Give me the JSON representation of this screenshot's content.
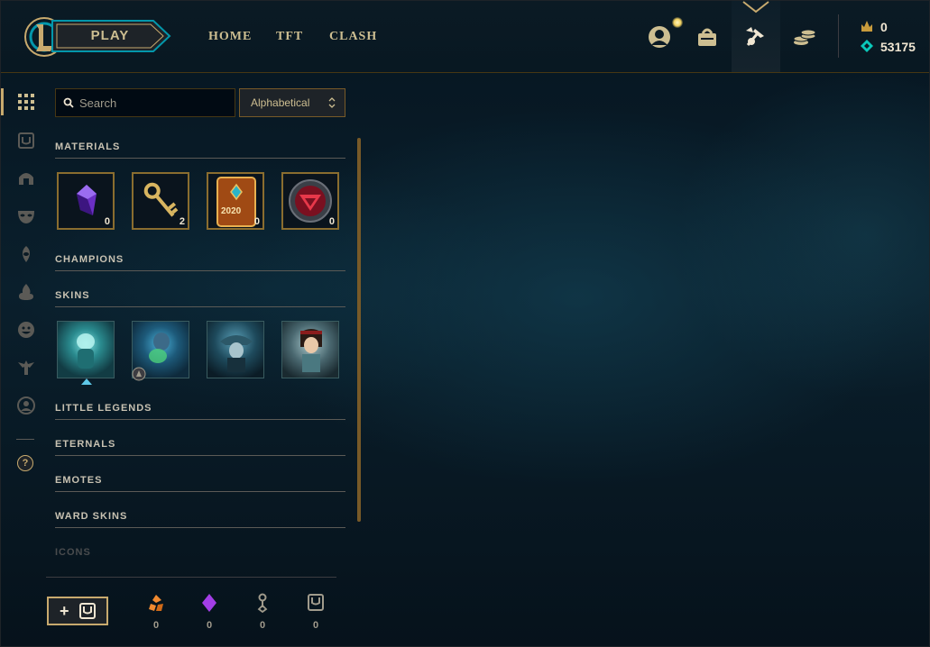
{
  "header": {
    "play_label": "PLAY",
    "nav": [
      "HOME",
      "TFT",
      "CLASH"
    ],
    "icons": [
      "profile-icon",
      "collection-icon",
      "loot-icon",
      "store-icon"
    ],
    "currency": {
      "rp": "0",
      "be": "53175"
    }
  },
  "sidebar": {
    "icons": [
      "grid-icon",
      "chest-icon",
      "helmet-icon",
      "mask-icon",
      "ward-icon",
      "flame-icon",
      "emote-icon",
      "little-legend-icon",
      "profile-circle-icon",
      "help-icon"
    ],
    "help_label": "?"
  },
  "search": {
    "placeholder": "Search",
    "value": ""
  },
  "sort": {
    "selected": "Alphabetical"
  },
  "sections": {
    "materials": "MATERIALS",
    "champions": "CHAMPIONS",
    "skins": "SKINS",
    "little_legends": "LITTLE LEGENDS",
    "eternals": "ETERNALS",
    "emotes": "EMOTES",
    "ward_skins": "WARD SKINS",
    "icons": "ICONS"
  },
  "materials": [
    {
      "icon": "crystal-icon",
      "count": "0"
    },
    {
      "icon": "key-fragment-icon",
      "count": "2"
    },
    {
      "icon": "event-2020-icon",
      "label": "2020",
      "count": "0"
    },
    {
      "icon": "token-orb-icon",
      "count": "0"
    }
  ],
  "skins": [
    {
      "icon": "skin-1"
    },
    {
      "icon": "skin-2"
    },
    {
      "icon": "skin-3"
    },
    {
      "icon": "skin-4"
    }
  ],
  "footer": {
    "craft_plus": "+",
    "essences": [
      {
        "icon": "orange-essence-icon",
        "value": "0"
      },
      {
        "icon": "mythic-essence-icon",
        "value": "0"
      },
      {
        "icon": "key-icon",
        "value": "0"
      },
      {
        "icon": "chest-icon",
        "value": "0"
      }
    ]
  },
  "colors": {
    "gold": "#c8aa6e",
    "text": "#cdbe91",
    "bg": "#010a13",
    "rp": "#c89b3c",
    "be": "#0ac8b9"
  }
}
